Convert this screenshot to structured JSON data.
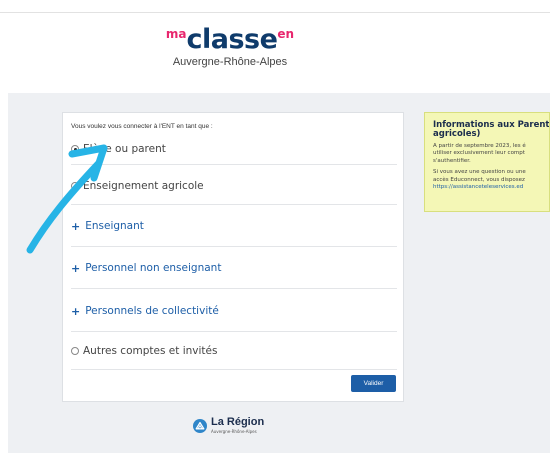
{
  "header": {
    "logo_ma": "ma",
    "logo_classe": "classe",
    "logo_en": "en",
    "logo_subtitle": "Auvergne-Rhône-Alpes"
  },
  "login": {
    "prompt": "Vous voulez vous connecter à l'ENT en tant que :",
    "options": [
      {
        "label": "Elève ou parent",
        "type": "radio",
        "checked": true
      },
      {
        "label": "Enseignement agricole",
        "type": "radio",
        "checked": false
      },
      {
        "label": "Enseignant",
        "type": "expand"
      },
      {
        "label": "Personnel non enseignant",
        "type": "expand"
      },
      {
        "label": "Personnels de collectivité",
        "type": "expand"
      },
      {
        "label": "Autres comptes et invités",
        "type": "radio",
        "checked": false
      }
    ],
    "plus_symbol": "+",
    "submit_label": "Valider"
  },
  "info_box": {
    "title_line1": "Informations aux Parents",
    "title_line2": "agricoles)",
    "para1": [
      "A partir de septembre 2023, les é",
      "utiliser exclusivement leur compt",
      "s'authentifier."
    ],
    "para2": [
      "Si vous avez une question ou une",
      "accès Educonnect, vous disposez"
    ],
    "link": "https://assistanceteleservices.ed"
  },
  "footer": {
    "region_name": "La Région",
    "region_sub": "Auvergne-Rhône-Alpes"
  },
  "colors": {
    "primary_blue": "#1d5ea7",
    "brand_pink": "#e8276e",
    "annotation_arrow": "#27b4e6",
    "info_bg": "#f4f7b6"
  }
}
